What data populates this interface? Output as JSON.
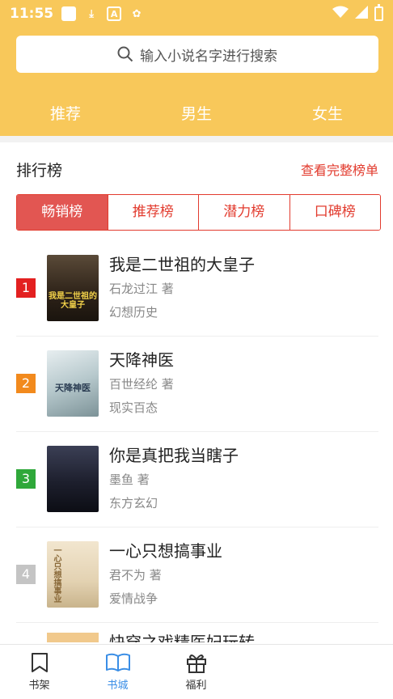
{
  "status": {
    "time": "11:55"
  },
  "search": {
    "placeholder": "输入小说名字进行搜索"
  },
  "categories": [
    "推荐",
    "男生",
    "女生"
  ],
  "section": {
    "title": "排行榜",
    "link": "查看完整榜单"
  },
  "tabs": [
    {
      "label": "畅销榜",
      "active": true
    },
    {
      "label": "推荐榜",
      "active": false
    },
    {
      "label": "潜力榜",
      "active": false
    },
    {
      "label": "口碑榜",
      "active": false
    }
  ],
  "books": [
    {
      "rank": "1",
      "title": "我是二世祖的大皇子",
      "author": "石龙过江 著",
      "genre": "幻想历史",
      "cover_text": "我是二世祖的大皇子",
      "rank_color": "#e32020",
      "cover_color": "#3a2a1c",
      "cover_text_color": "#f3d24a"
    },
    {
      "rank": "2",
      "title": "天降神医",
      "author": "百世经纶 著",
      "genre": "现实百态",
      "cover_text": "天降神医",
      "rank_color": "#f28a1d",
      "cover_color": "#c9d7d9",
      "cover_text_color": "#2a3c52"
    },
    {
      "rank": "3",
      "title": "你是真把我当瞎子",
      "author": "墨鱼 著",
      "genre": "东方玄幻",
      "cover_text": "",
      "rank_color": "#2fa83a",
      "cover_color": "#1d1f2d",
      "cover_text_color": "#ffffff"
    },
    {
      "rank": "4",
      "title": "一心只想搞事业",
      "author": "君不为 著",
      "genre": "爱情战争",
      "cover_text": "一心只想搞事业",
      "rank_color": "#c4c4c4",
      "cover_color": "#e9dcc4",
      "cover_text_color": "#8a6a3a"
    }
  ],
  "partial_title": "快穿之戏精医妃玩转",
  "bottom_nav": [
    {
      "label": "书架",
      "icon": "bookmark-icon",
      "active": false
    },
    {
      "label": "书城",
      "icon": "open-book-icon",
      "active": true
    },
    {
      "label": "福利",
      "icon": "gift-icon",
      "active": false
    }
  ]
}
